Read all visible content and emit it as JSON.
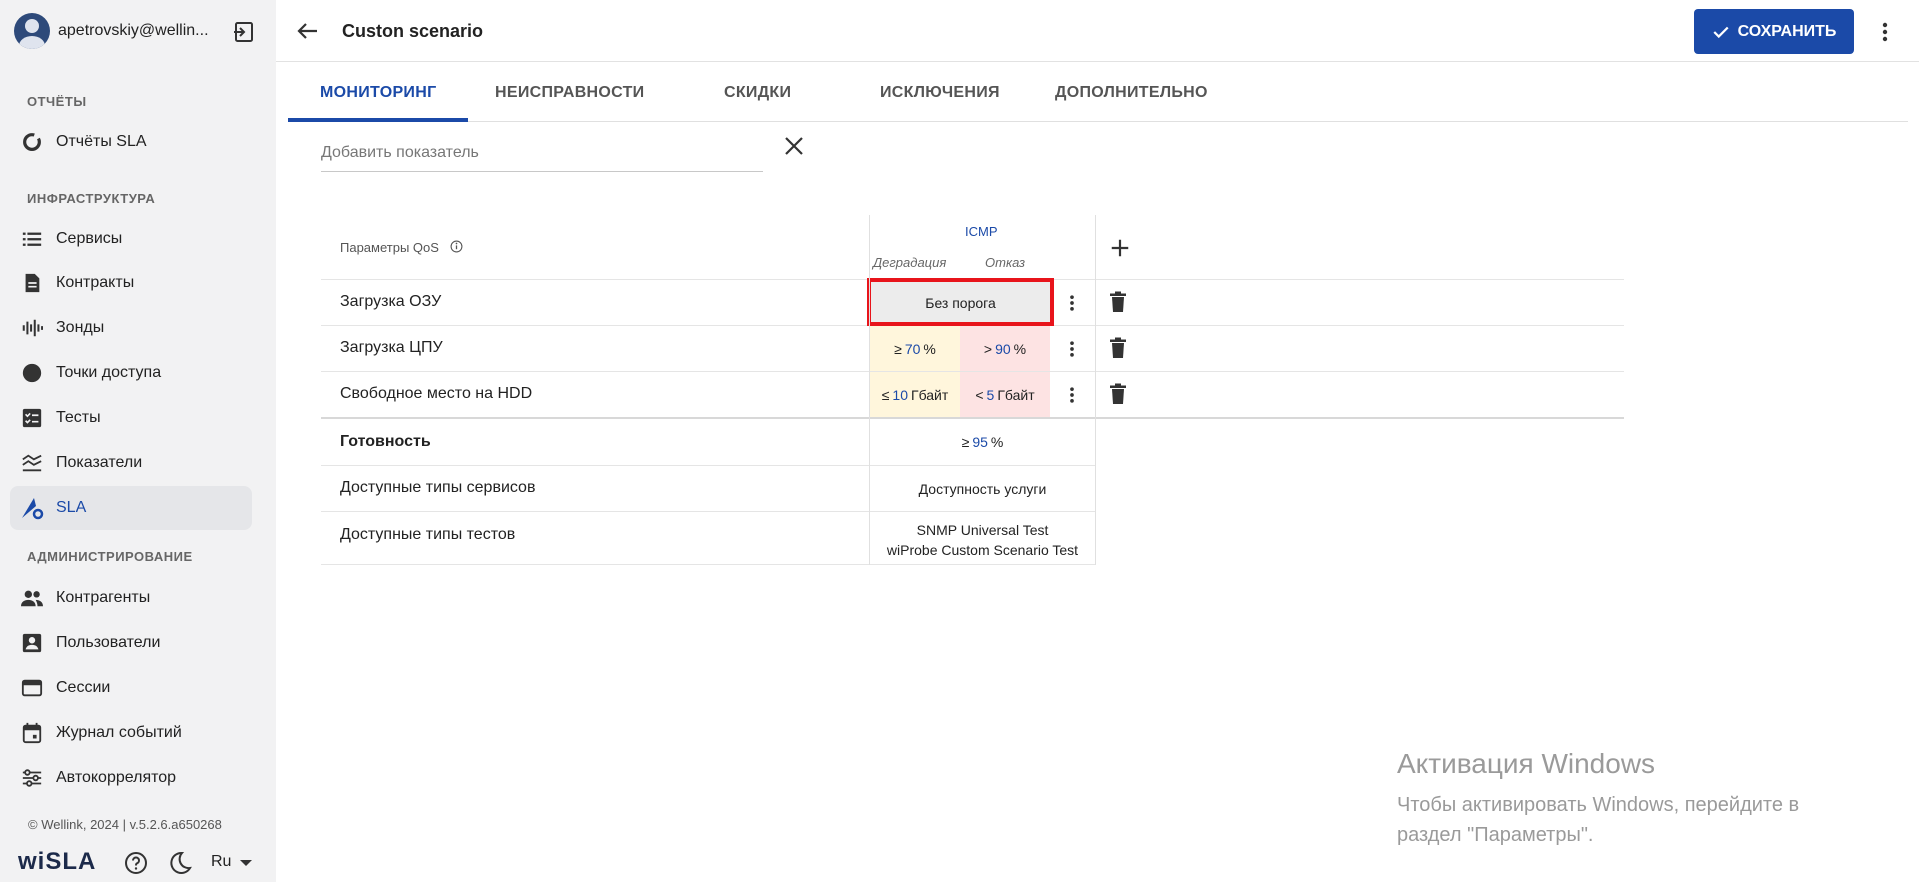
{
  "user": {
    "email": "apetrovskiy@wellin..."
  },
  "sidebar": {
    "sections": [
      {
        "title": "ОТЧЁТЫ"
      },
      {
        "title": "ИНФРАСТРУКТУРА"
      },
      {
        "title": "АДМИНИСТРИРОВАНИЕ"
      }
    ],
    "items": [
      {
        "label": "Отчёты SLA",
        "icon": "donut-chart-icon"
      },
      {
        "label": "Сервисы",
        "icon": "list-icon"
      },
      {
        "label": "Контракты",
        "icon": "document-icon"
      },
      {
        "label": "Зонды",
        "icon": "waveform-icon"
      },
      {
        "label": "Точки доступа",
        "icon": "circle-icon"
      },
      {
        "label": "Тесты",
        "icon": "checklist-icon"
      },
      {
        "label": "Показатели",
        "icon": "metrics-icon"
      },
      {
        "label": "SLA",
        "icon": "sla-settings-icon",
        "active": true
      },
      {
        "label": "Контрагенты",
        "icon": "people-icon"
      },
      {
        "label": "Пользователи",
        "icon": "user-card-icon"
      },
      {
        "label": "Сессии",
        "icon": "window-icon"
      },
      {
        "label": "Журнал событий",
        "icon": "calendar-icon"
      },
      {
        "label": "Автокоррелятор",
        "icon": "sliders-icon"
      }
    ],
    "footer": {
      "copyright": "© Wellink, 2024 | v.5.2.6.a650268",
      "brand": "wiSLA",
      "lang": "Ru"
    }
  },
  "header": {
    "title": "Custon scenario",
    "save_label": "СОХРАНИТЬ"
  },
  "tabs": [
    {
      "label": "МОНИТОРИНГ",
      "active": true
    },
    {
      "label": "НЕИСПРАВНОСТИ"
    },
    {
      "label": "СКИДКИ"
    },
    {
      "label": "ИСКЛЮЧЕНИЯ"
    },
    {
      "label": "ДОПОЛНИТЕЛЬНО"
    }
  ],
  "add_indicator": {
    "placeholder": "Добавить показатель"
  },
  "table": {
    "param_header": "Параметры QoS",
    "test_column": "ICMP",
    "degradation_header": "Деградация",
    "failure_header": "Отказ",
    "rows": [
      {
        "label": "Загрузка ОЗУ",
        "no_threshold": "Без порога"
      },
      {
        "label": "Загрузка ЦПУ",
        "deg_op": "≥",
        "deg_val": "70",
        "deg_unit": "%",
        "fail_op": ">",
        "fail_val": "90",
        "fail_unit": "%"
      },
      {
        "label": "Свободное место на HDD",
        "deg_op": "≤",
        "deg_val": "10",
        "deg_unit": "Гбайт",
        "fail_op": "<",
        "fail_val": "5",
        "fail_unit": "Гбайт"
      }
    ],
    "availability": {
      "label": "Готовность",
      "op": "≥",
      "val": "95",
      "unit": "%"
    },
    "service_types": {
      "label": "Доступные типы сервисов",
      "value": "Доступность услуги"
    },
    "test_types": {
      "label": "Доступные типы тестов",
      "values": [
        "SNMP Universal Test",
        "wiProbe Custom Scenario Test"
      ]
    }
  },
  "windows_watermark": {
    "title": "Активация Windows",
    "line1": "Чтобы активировать Windows, перейдите в",
    "line2": "раздел \"Параметры\"."
  },
  "colors": {
    "accent": "#1b4aa8",
    "degradation": "#fff6dc",
    "failure": "#fde3e3",
    "highlight": "#e8141b"
  }
}
